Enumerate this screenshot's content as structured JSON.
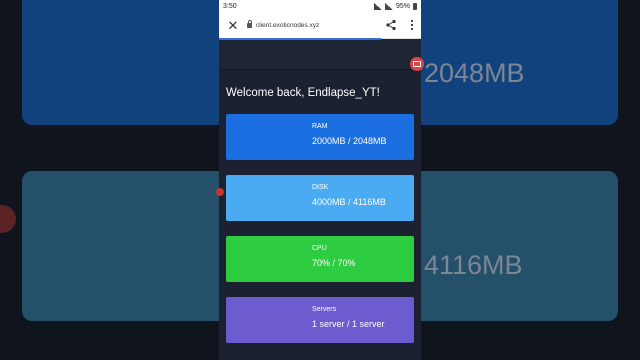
{
  "status": {
    "time": "3:50",
    "battery": "95%"
  },
  "browser": {
    "url": "client.exoticnodes.xyz"
  },
  "page": {
    "welcome": "Welcome back, Endlapse_YT!"
  },
  "background": {
    "ram_text": "2048MB",
    "disk_text": "4116MB"
  },
  "cards": [
    {
      "label": "RAM",
      "value": "2000MB / 2048MB",
      "color": "#1c6fe0"
    },
    {
      "label": "DISK",
      "value": "4000MB / 4116MB",
      "color": "#4aaaf2"
    },
    {
      "label": "CPU",
      "value": "70% / 70%",
      "color": "#2ecc40"
    },
    {
      "label": "Servers",
      "value": "1 server / 1 server",
      "color": "#6d5bd0"
    }
  ],
  "icons": {
    "close": "close-icon",
    "lock": "lock-icon",
    "share": "share-icon",
    "menu": "more-vert-icon",
    "camera": "camera-icon"
  }
}
